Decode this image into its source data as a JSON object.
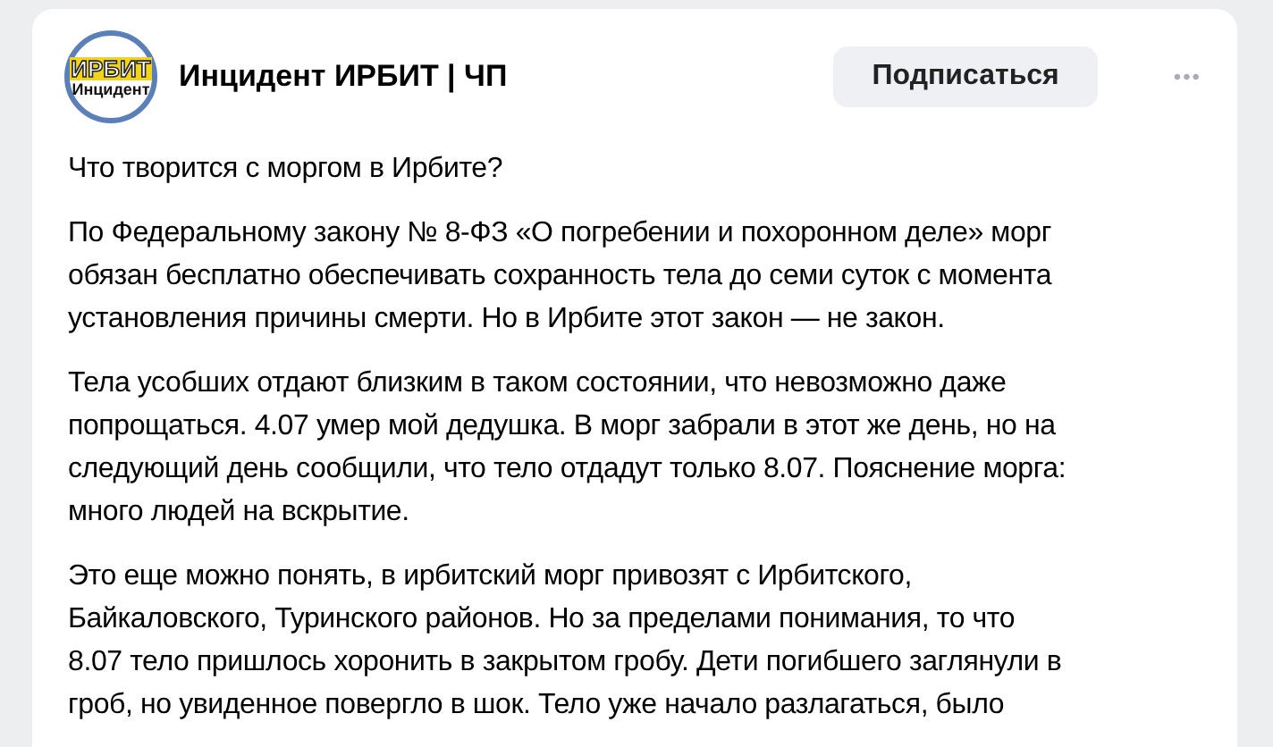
{
  "post": {
    "avatar": {
      "top": "ИРБИТ",
      "bottom": "Инцидент"
    },
    "author": "Инцидент ИРБИТ | ЧП",
    "subscribe_button": "Подписаться",
    "more": "•••",
    "paragraphs": [
      [
        "Что творится с моргом в Ирбите?"
      ],
      [
        "По Федеральному закону № 8-ФЗ «О погребении и похоронном деле» морг",
        "обязан бесплатно обеспечивать сохранность тела до семи суток с момента",
        "установления причины смерти. Но в Ирбите этот закон — не закон."
      ],
      [
        "Тела усобших отдают близким в таком состоянии, что невозможно даже",
        "попрощаться. 4.07 умер мой дедушка. В морг забрали в этот же день, но на",
        "следующий день сообщили, что тело отдадут только 8.07. Пояснение морга:",
        "много людей на вскрытие."
      ],
      [
        "Это еще можно понять, в ирбитский морг привозят с Ирбитского,",
        "Байкаловского, Туринского районов. Но за пределами понимания, то что",
        "8.07 тело пришлось хоронить в закрытом гробу. Дети погибшего заглянули в",
        "гроб, но увиденное повергло в шок. Тело уже начало разлагаться, было"
      ]
    ]
  }
}
